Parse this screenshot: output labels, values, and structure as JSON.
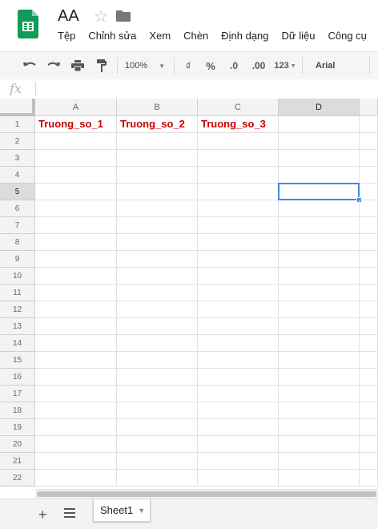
{
  "doc": {
    "title": "AA"
  },
  "menu": [
    "Tệp",
    "Chỉnh sửa",
    "Xem",
    "Chèn",
    "Định dạng",
    "Dữ liệu",
    "Công cụ"
  ],
  "toolbar": {
    "zoom": "100%",
    "currency": "₫",
    "percent": "%",
    "dec_decrease": ".0",
    "dec_increase": ".00",
    "more_formats": "123",
    "font": "Arial"
  },
  "formula_bar": {
    "fx": "fx",
    "value": ""
  },
  "columns": [
    "A",
    "B",
    "C",
    "D"
  ],
  "rows": [
    "1",
    "2",
    "3",
    "4",
    "5",
    "6",
    "7",
    "8",
    "9",
    "10",
    "11",
    "12",
    "13",
    "14",
    "15",
    "16",
    "17",
    "18",
    "19",
    "20",
    "21",
    "22"
  ],
  "cells": {
    "A1": "Truong_so_1",
    "B1": "Truong_so_2",
    "C1": "Truong_so_3"
  },
  "selection": {
    "active_cell": "D5",
    "selected_column": "D",
    "selected_row": "5"
  },
  "sheets": [
    {
      "name": "Sheet1",
      "active": true
    }
  ],
  "colors": {
    "text_red": "#cc0000",
    "selection_blue": "#4285f4",
    "sheets_green": "#0f9d58"
  }
}
